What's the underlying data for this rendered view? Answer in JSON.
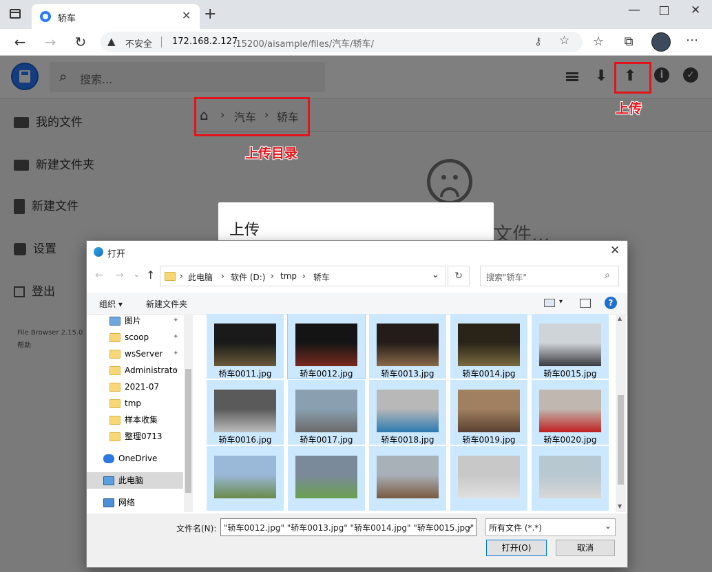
{
  "browser": {
    "tab_title": "轿车",
    "security_label": "不安全",
    "url_host": "172.168.2.127",
    "url_rest": ":15200/aisample/files/汽车/轿车/"
  },
  "app": {
    "search_placeholder": "搜索...",
    "sidebar": [
      {
        "label": "我的文件",
        "icon": "folder-icon"
      },
      {
        "label": "新建文件夹",
        "icon": "new-folder-icon"
      },
      {
        "label": "新建文件",
        "icon": "new-file-icon"
      },
      {
        "label": "设置",
        "icon": "settings-icon"
      },
      {
        "label": "登出",
        "icon": "logout-icon"
      }
    ],
    "footer_version": "File Browser 2.15.0",
    "footer_help": "帮助",
    "breadcrumb": [
      "汽车",
      "轿车"
    ],
    "empty_text": "文件...",
    "upload_modal_title": "上传"
  },
  "annotations": {
    "upload_label": "上传",
    "upload_dir_label": "上传目录"
  },
  "dialog": {
    "title": "打开",
    "path": [
      "此电脑",
      "软件 (D:)",
      "tmp",
      "轿车"
    ],
    "search_placeholder": "搜索\"轿车\"",
    "organize": "组织",
    "new_folder": "新建文件夹",
    "nav_items": [
      {
        "label": "图片",
        "pinned": true,
        "type": "picture"
      },
      {
        "label": "scoop",
        "pinned": true,
        "type": "folder"
      },
      {
        "label": "wsServer",
        "pinned": true,
        "type": "folder"
      },
      {
        "label": "Administrato",
        "pinned": true,
        "type": "folder"
      },
      {
        "label": "2021-07",
        "pinned": false,
        "type": "folder"
      },
      {
        "label": "tmp",
        "pinned": false,
        "type": "folder"
      },
      {
        "label": "样本收集",
        "pinned": false,
        "type": "folder"
      },
      {
        "label": "整理0713",
        "pinned": false,
        "type": "folder"
      },
      {
        "label": "OneDrive",
        "pinned": false,
        "type": "cloud"
      },
      {
        "label": "此电脑",
        "pinned": false,
        "type": "pc"
      },
      {
        "label": "网络",
        "pinned": false,
        "type": "network"
      }
    ],
    "files": [
      {
        "name": "桥车0011.jpg",
        "colors": [
          "#1a1a1a",
          "#6b5a3a"
        ]
      },
      {
        "name": "轿车0012.jpg",
        "colors": [
          "#141414",
          "#7a2a20"
        ]
      },
      {
        "name": "轿车0013.jpg",
        "colors": [
          "#241c18",
          "#8a6a4a"
        ]
      },
      {
        "name": "轿车0014.jpg",
        "colors": [
          "#2a2418",
          "#7a6a40"
        ]
      },
      {
        "name": "轿车0015.jpg",
        "colors": [
          "#cfd4d8",
          "#3a3a40"
        ]
      },
      {
        "name": "轿车0016.jpg",
        "colors": [
          "#5a5a5a",
          "#bdbdbd"
        ]
      },
      {
        "name": "轿车0017.jpg",
        "colors": [
          "#8aa0b0",
          "#6a6a6a"
        ]
      },
      {
        "name": "轿车0018.jpg",
        "colors": [
          "#b8b8b8",
          "#2a7ab0"
        ]
      },
      {
        "name": "轿车0019.jpg",
        "colors": [
          "#a08060",
          "#5a4030"
        ]
      },
      {
        "name": "轿车0020.jpg",
        "colors": [
          "#c0b8b0",
          "#c02020"
        ]
      },
      {
        "name": "",
        "colors": [
          "#9ab8d8",
          "#6a8a4a"
        ]
      },
      {
        "name": "",
        "colors": [
          "#7a8a9a",
          "#6aa050"
        ]
      },
      {
        "name": "",
        "colors": [
          "#a8b0b8",
          "#7a5a40"
        ]
      },
      {
        "name": "",
        "colors": [
          "#c8c8c8",
          "#e0e0e0"
        ]
      },
      {
        "name": "",
        "colors": [
          "#b8c8d0",
          "#d8d8d8"
        ]
      }
    ],
    "filename_label": "文件名(N):",
    "filename_value": "\"轿车0012.jpg\" \"轿车0013.jpg\" \"轿车0014.jpg\" \"轿车0015.jpg\"",
    "filetype_value": "所有文件 (*.*)",
    "open_button": "打开(O)",
    "cancel_button": "取消"
  },
  "colors": {
    "accent": "#2979ff",
    "annotation_red": "#e2141b",
    "selection": "#cce8ff"
  }
}
